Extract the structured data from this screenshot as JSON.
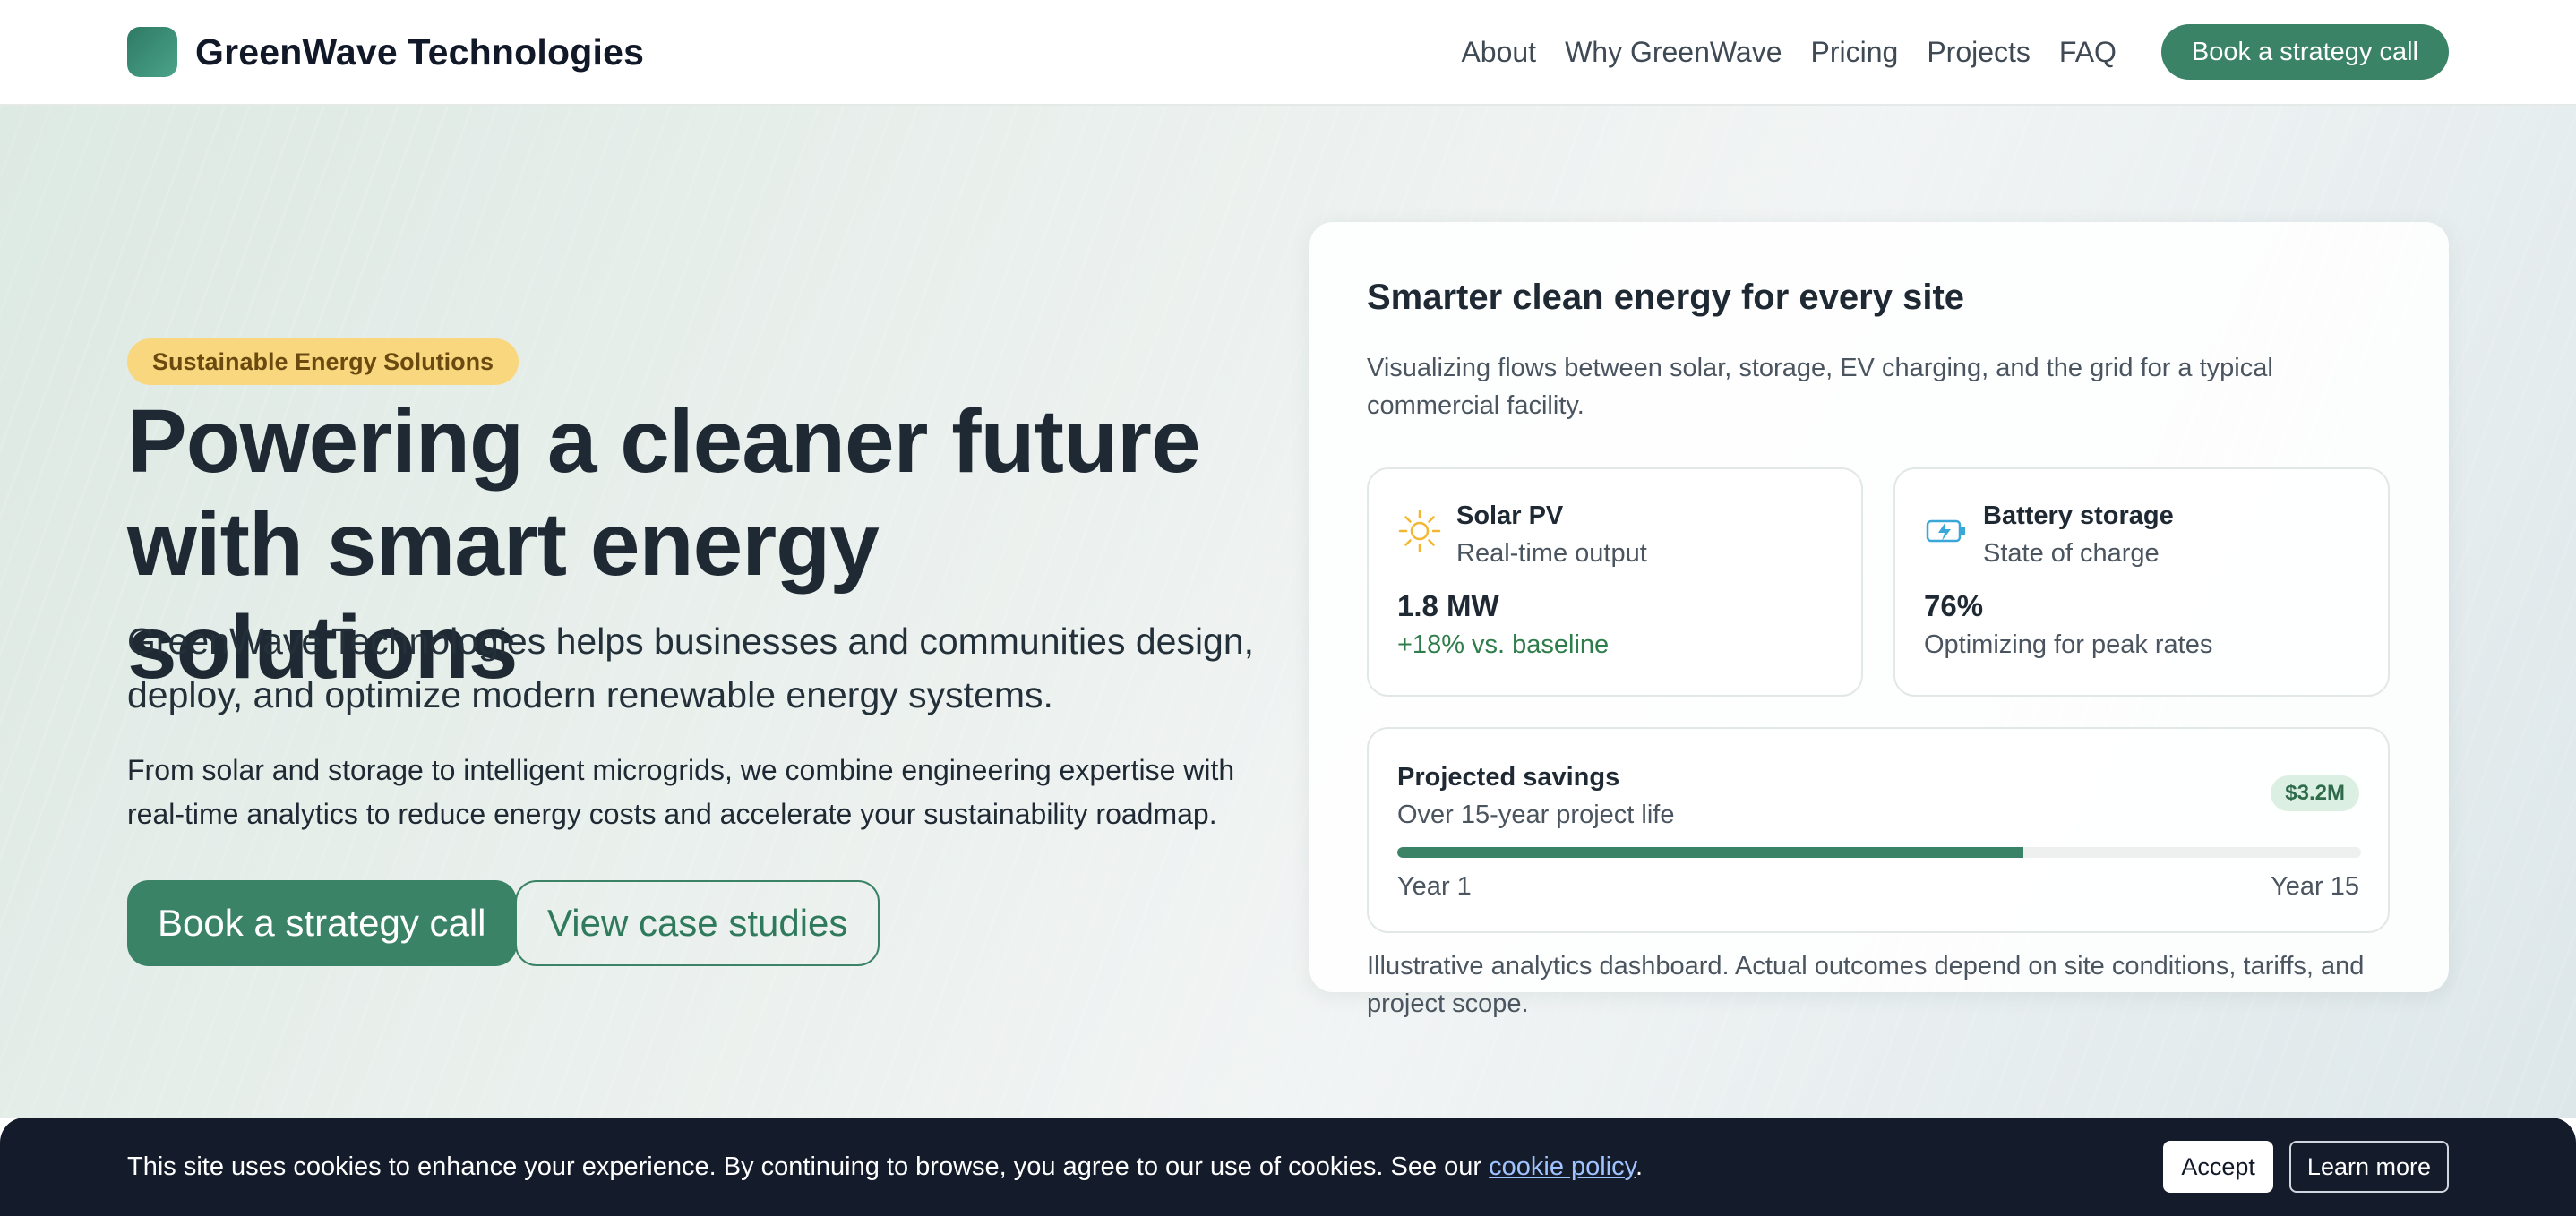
{
  "header": {
    "brand_name": "GreenWave Technologies",
    "logo_icon": "logo-square-icon",
    "nav": [
      "About",
      "Why GreenWave",
      "Pricing",
      "Projects",
      "FAQ"
    ],
    "cta_label": "Book a strategy call"
  },
  "hero": {
    "badge": "Sustainable Energy Solutions",
    "title_line1": "Powering a cleaner future",
    "title_line2": "with smart energy solutions",
    "lead": "GreenWave Technologies helps businesses and communities design, deploy, and optimize modern renewable energy systems.",
    "body": "From solar and storage to intelligent microgrids, we combine engineering expertise with real-time analytics to reduce energy costs and accelerate your sustainability roadmap.",
    "primary_button": "Book a strategy call",
    "secondary_button": "View case studies"
  },
  "dashboard": {
    "title": "Smarter clean energy for every site",
    "description": "Visualizing flows between solar, storage, EV charging, and the grid for a typical commercial facility.",
    "metrics": [
      {
        "icon": "sun-icon",
        "title": "Solar PV",
        "subtitle": "Real-time output",
        "value": "1.8 MW",
        "note": "+18% vs. baseline"
      },
      {
        "icon": "battery-charging-icon",
        "title": "Battery storage",
        "subtitle": "State of charge",
        "value": "76%",
        "note": "Optimizing for peak rates"
      }
    ],
    "savings": {
      "title": "Projected savings",
      "subtitle": "Over 15-year project life",
      "amount": "$3.2M",
      "progress_fraction": 0.65,
      "start_label": "Year 1",
      "end_label": "Year 15"
    },
    "footnote": "Illustrative analytics dashboard. Actual outcomes depend on site conditions, tariffs, and project scope."
  },
  "cookie": {
    "text_before": "This site uses cookies to enhance your experience. By continuing to browse, you agree to our use of cookies. See our ",
    "link_label": "cookie policy",
    "text_after": ".",
    "accept_label": "Accept",
    "learn_label": "Learn more"
  },
  "colors": {
    "brand_green": "#3a8366",
    "badge_yellow": "#f8d77e",
    "solar_yellow": "#f2b632",
    "battery_blue": "#3aa7d9",
    "cookie_bg": "#141b2a"
  }
}
